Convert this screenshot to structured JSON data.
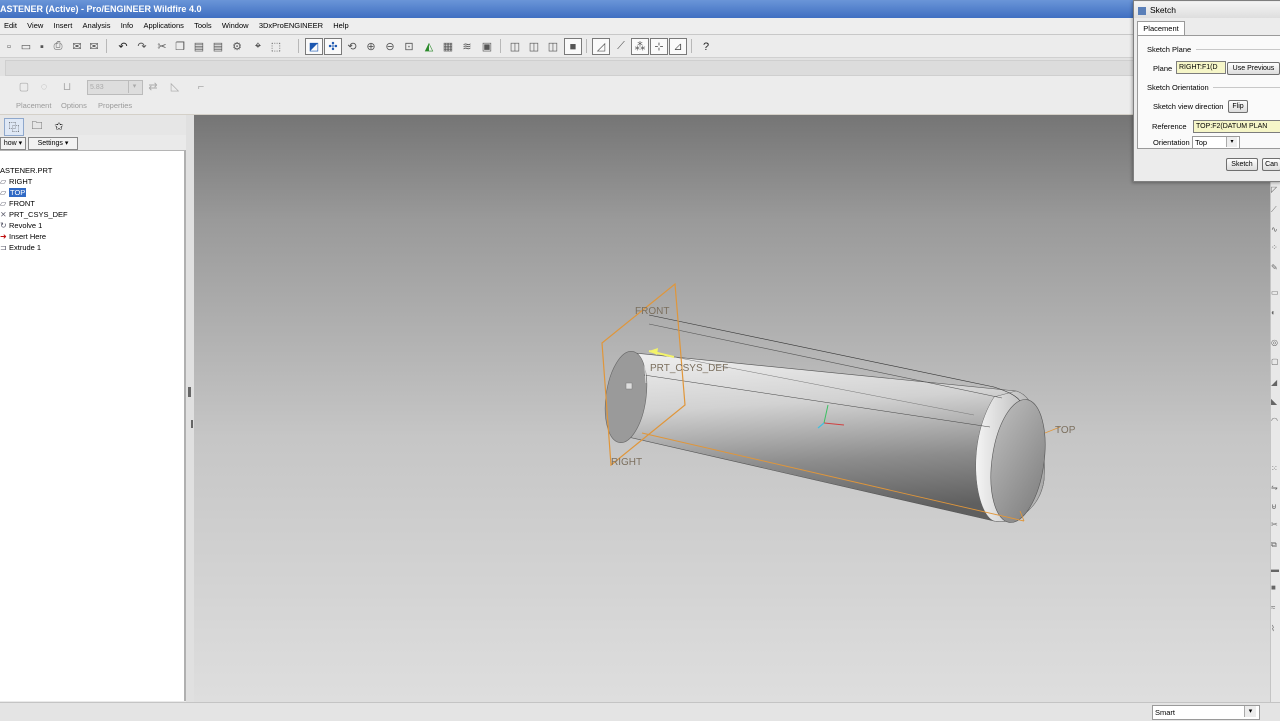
{
  "window": {
    "title": "ASTENER (Active) - Pro/ENGINEER Wildfire 4.0"
  },
  "menu": [
    "Edit",
    "View",
    "Insert",
    "Analysis",
    "Info",
    "Applications",
    "Tools",
    "Window",
    "3DxProENGINEER",
    "Help"
  ],
  "dashboard": {
    "depth_value": "5.83",
    "tabs": [
      "Placement",
      "Options",
      "Properties"
    ]
  },
  "model_tree": {
    "show_label": "how ▾",
    "settings_label": "Settings ▾",
    "items": [
      {
        "label": "ASTENER.PRT",
        "icon": "part-icon"
      },
      {
        "label": "RIGHT",
        "icon": "datum-plane-icon"
      },
      {
        "label": "TOP",
        "icon": "datum-plane-icon",
        "selected": true
      },
      {
        "label": "FRONT",
        "icon": "datum-plane-icon"
      },
      {
        "label": "PRT_CSYS_DEF",
        "icon": "csys-icon"
      },
      {
        "label": "Revolve 1",
        "icon": "revolve-icon"
      },
      {
        "label": "Insert Here",
        "icon": "insert-arrow-icon"
      },
      {
        "label": "Extrude 1",
        "icon": "extrude-icon"
      }
    ]
  },
  "viewport": {
    "labels": {
      "front": "FRONT",
      "csys": "PRT_CSYS_DEF",
      "right": "RIGHT",
      "top": "TOP"
    }
  },
  "status": {
    "filter": "Smart"
  },
  "sketch_dialog": {
    "title": "Sketch",
    "tab": "Placement",
    "sketch_plane_heading": "Sketch Plane",
    "plane_label": "Plane",
    "plane_value": "RIGHT:F1(D",
    "use_previous": "Use Previous",
    "orientation_heading": "Sketch Orientation",
    "view_direction_label": "Sketch view direction",
    "flip": "Flip",
    "reference_label": "Reference",
    "reference_value": "TOP:F2(DATUM PLAN",
    "orientation_label": "Orientation",
    "orientation_value": "Top",
    "sketch_button": "Sketch",
    "cancel_button": "Can"
  },
  "colors": {
    "datum_orange": "#e0963a",
    "selection_blue": "#316ac5",
    "title_blue": "#3f6fc1"
  }
}
